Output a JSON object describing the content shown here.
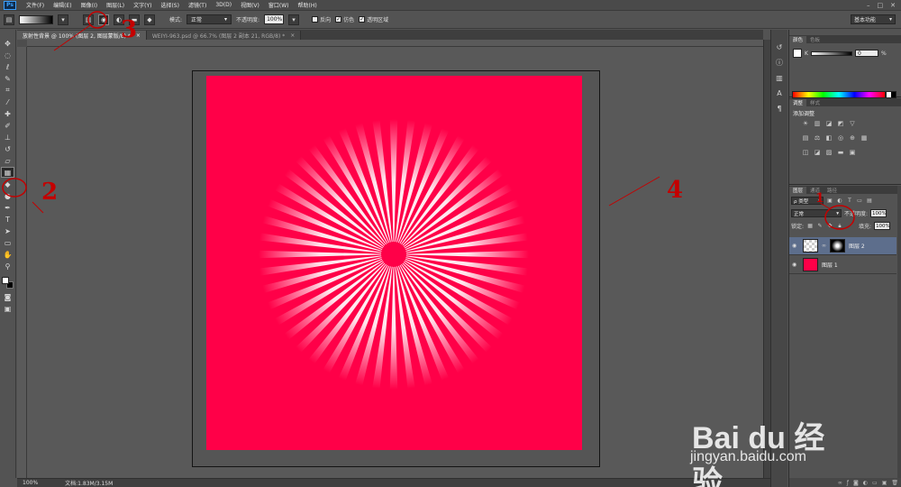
{
  "app": {
    "logo": "Ps"
  },
  "menu": [
    "文件(F)",
    "编辑(E)",
    "图像(I)",
    "图层(L)",
    "文字(Y)",
    "选择(S)",
    "滤镜(T)",
    "3D(D)",
    "视图(V)",
    "窗口(W)",
    "帮助(H)"
  ],
  "window_controls": [
    "–",
    "□",
    "✕"
  ],
  "options": {
    "mode_label": "模式:",
    "mode_value": "正常",
    "opacity_label": "不透明度:",
    "opacity_value": "100%",
    "reverse_label": "反向",
    "dither_label": "仿色",
    "transparency_label": "透明区域",
    "workspace": "基本功能"
  },
  "tabs": [
    {
      "title": "放射性背景 @ 100% (图层 2, 图层蒙版/8) *",
      "close": "×"
    },
    {
      "title": "WEIYI-963.psd @ 66.7% (图层 2 副本 21, RGB/8) *",
      "close": "×"
    }
  ],
  "status": {
    "zoom": "100%",
    "doc": "文档:1.83M/3.15M"
  },
  "panels": {
    "color_tabs": [
      "颜色",
      "色板"
    ],
    "color_channel": "K",
    "color_value": "0",
    "color_unit": "%",
    "adjust_tabs": [
      "调整",
      "样式"
    ],
    "adjust_title": "添加调整",
    "layer_tabs": [
      "图层",
      "通道",
      "路径"
    ],
    "kind_label": "ρ 类型",
    "blend_mode": "正常",
    "opacity_label": "不透明度:",
    "opacity_value": "100%",
    "lock_label": "锁定:",
    "fill_label": "填充:",
    "fill_value": "100%",
    "layers": [
      {
        "name": "图层 2"
      },
      {
        "name": "图层 1"
      }
    ]
  },
  "annotations": [
    "1",
    "2",
    "3",
    "4"
  ],
  "watermark": {
    "text": "Bai du 经验",
    "url": "jingyan.baidu.com"
  },
  "colors": {
    "artwork": "#ff0048",
    "annotation": "#c40000",
    "selected_layer": "#5d6e8c"
  }
}
